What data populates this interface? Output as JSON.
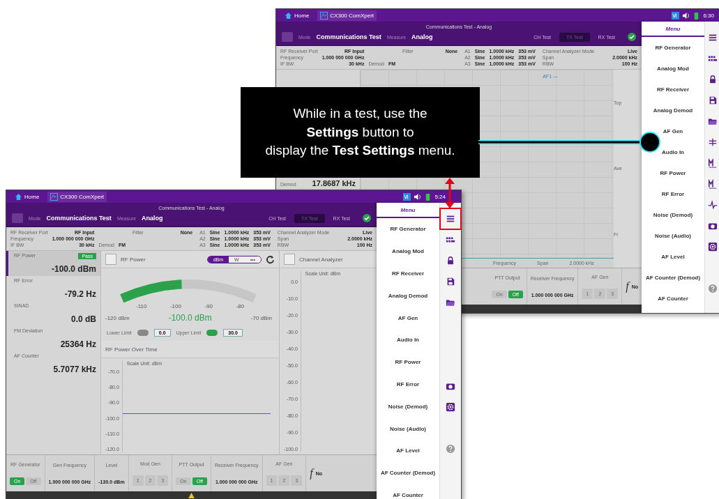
{
  "callout": {
    "lines": [
      "While in a test, use the",
      "**Settings** button to",
      "display the **Test Settings** menu."
    ]
  },
  "back": {
    "topbar": {
      "home": "Home",
      "app": "CX300 ComXpert",
      "time": "6:30"
    },
    "header": {
      "title": "Communications Test - Analog",
      "mode_label": "Mode",
      "mode": "Communications Test",
      "measure_label": "Measure",
      "measure": "Analog",
      "tabs": [
        {
          "label": "CH Test",
          "selected": false
        },
        {
          "label": "TX Test",
          "selected": true
        },
        {
          "label": "RX Test",
          "selected": false
        }
      ]
    },
    "info": {
      "receiver": [
        [
          "RF Receiver Port",
          "RF Input"
        ],
        [
          "Frequency",
          "1.000 000 000 GHz"
        ],
        [
          "IF BW",
          "30 kHz",
          "Demod",
          "FM"
        ]
      ],
      "filter": [
        "Filter",
        "None"
      ],
      "tones": [
        [
          "A1",
          "Sine",
          "1.0000 kHz",
          "353 mV"
        ],
        [
          "A2",
          "Sine",
          "1.0000 kHz",
          "353 mV"
        ],
        [
          "A3",
          "Sine",
          "1.0000 kHz",
          "353 mV"
        ]
      ],
      "analyzer": [
        [
          "Channel Analyzer Mode",
          "Live"
        ],
        [
          "Span",
          "2.0000 kHz"
        ],
        [
          "RBW",
          "100 Hz"
        ]
      ]
    },
    "reading": {
      "label": "Demod",
      "value": "17.8687 kHz"
    },
    "chart": {
      "marker": "AF1 —",
      "side_labels": [
        "Top",
        "Ave",
        "Fr"
      ],
      "footer": [
        "Frequency",
        "Span",
        "2.0000 kHz"
      ]
    },
    "bottom": [
      {
        "kind": "toggle",
        "label": "PTT Output",
        "options": [
          {
            "label": "On",
            "selected": false
          },
          {
            "label": "Off",
            "selected": true
          }
        ]
      },
      {
        "kind": "value",
        "label": "Receiver Frequency",
        "value": "1.000 000 000 GHz"
      },
      {
        "kind": "keys",
        "label": "AF Gen",
        "options": [
          {
            "label": "1",
            "selected": false
          },
          {
            "label": "2",
            "selected": false
          },
          {
            "label": "3",
            "selected": false
          }
        ]
      },
      {
        "kind": "func",
        "label": "f",
        "value": "No"
      }
    ],
    "menu": {
      "title": "Menu",
      "items": [
        "RF Generator",
        "Analog Mod",
        "RF Receiver",
        "Analog Demod",
        "AF Gen",
        "Audio In",
        "RF Power",
        "RF Error",
        "Noise (Demod)",
        "Noise (Audio)",
        "AF Level",
        "AF Counter (Demod)",
        "AF Counter"
      ]
    },
    "icons": [
      {
        "kind": "menu"
      },
      {
        "kind": "grid"
      },
      {
        "kind": "lock"
      },
      {
        "kind": "save"
      },
      {
        "kind": "folder"
      },
      {
        "kind": "filter"
      },
      {
        "kind": "marker"
      },
      {
        "kind": "marker"
      },
      {
        "kind": "pulse"
      },
      {
        "kind": "camera"
      },
      {
        "kind": "settings"
      },
      {
        "kind": "spacer"
      },
      {
        "kind": "help"
      }
    ]
  },
  "front": {
    "topbar": {
      "home": "Home",
      "app": "CX300 ComXpert",
      "time": "5:24"
    },
    "header": {
      "title": "Communications Test - Analog",
      "mode_label": "Mode",
      "mode": "Communications Test",
      "measure_label": "Measure",
      "measure": "Analog",
      "tabs": [
        {
          "label": "CH Test",
          "selected": false
        },
        {
          "label": "TX Test",
          "selected": true
        },
        {
          "label": "RX Test",
          "selected": false
        }
      ]
    },
    "info": {
      "receiver": [
        [
          "RF Receiver Port",
          "RF Input"
        ],
        [
          "Frequency",
          "1.000 000 000 GHz"
        ],
        [
          "IF BW",
          "30 kHz",
          "Demod",
          "FM"
        ]
      ],
      "filter": [
        "Filter",
        "None"
      ],
      "tones": [
        [
          "A1",
          "Sine",
          "1.0000 kHz",
          "353 mV"
        ],
        [
          "A2",
          "Sine",
          "1.0000 kHz",
          "353 mV"
        ],
        [
          "A3",
          "Sine",
          "1.0000 kHz",
          "353 mV"
        ]
      ],
      "analyzer": [
        [
          "Channel Analyzer Mode",
          "Live"
        ],
        [
          "Span",
          "2.0000 kHz"
        ],
        [
          "RBW",
          "100 Hz"
        ]
      ]
    },
    "readings": [
      {
        "label": "RF Power",
        "value": "-100.0 dBm",
        "badge": "Pass",
        "selected": true
      },
      {
        "label": "RF Error",
        "value": "-79.2 Hz",
        "selected": false
      },
      {
        "label": "SINAD",
        "value": "0.0 dB",
        "selected": false
      },
      {
        "label": "FM Deviation",
        "value": "25364 Hz",
        "selected": false
      },
      {
        "label": "AF Counter",
        "value": "5.7077 kHz",
        "selected": false
      }
    ],
    "rf_power": {
      "title": "RF Power",
      "units": [
        {
          "label": "dBm",
          "selected": true
        },
        {
          "label": "W",
          "selected": false
        },
        {
          "label": "•••",
          "selected": false
        }
      ],
      "scale": [
        "-110",
        "-100",
        "-90",
        "-80"
      ],
      "min": "-120 dBm",
      "max": "-70 dBm",
      "reading": "-100.0 dBm",
      "level": 0.45,
      "limits": [
        {
          "label": "Lower Limit",
          "on": false,
          "value": "0.0"
        },
        {
          "label": "Upper Limit",
          "on": true,
          "value": "30.0"
        }
      ]
    },
    "over_time": {
      "title": "RF Power Over Time",
      "scale": "Scale Unit: dBm",
      "yticks": [
        "-70.0",
        "-80.0",
        "-90.0",
        "-100.0",
        "-110.0",
        "-120.0"
      ]
    },
    "analyzer": {
      "title": "Channel Analyzer",
      "scale": "Scale Unit: dBm",
      "yticks": [
        "0.0",
        "-10.0",
        "-20.0",
        "-30.0",
        "-40.0",
        "-50.0",
        "-60.0",
        "-70.0",
        "-80.0",
        "-90.0",
        "-100.0"
      ]
    },
    "bottom": [
      {
        "kind": "toggle",
        "label": "RF Generator",
        "options": [
          {
            "label": "On",
            "selected": true
          },
          {
            "label": "Off",
            "selected": false
          }
        ]
      },
      {
        "kind": "value",
        "label": "Gen Frequency",
        "value": "1.000 000 000 GHz"
      },
      {
        "kind": "value",
        "label": "Level",
        "value": "-130.0 dBm"
      },
      {
        "kind": "keys",
        "label": "Mod Gen",
        "options": [
          {
            "label": "1",
            "selected": false
          },
          {
            "label": "2",
            "selected": false
          },
          {
            "label": "3",
            "selected": false
          }
        ]
      },
      {
        "kind": "toggle",
        "label": "PTT Output",
        "options": [
          {
            "label": "On",
            "selected": false
          },
          {
            "label": "Off",
            "selected": true
          }
        ]
      },
      {
        "kind": "value",
        "label": "Receiver Frequency",
        "value": "1.000 000 000 GHz"
      },
      {
        "kind": "keys",
        "label": "AF Gen",
        "options": [
          {
            "label": "1",
            "selected": false
          },
          {
            "label": "2",
            "selected": false
          },
          {
            "label": "3",
            "selected": false
          }
        ]
      },
      {
        "kind": "func",
        "label": "f",
        "value": "No"
      }
    ],
    "menu": {
      "title": "Menu",
      "items": [
        "RF Generator",
        "Analog Mod",
        "RF Receiver",
        "Analog Demod",
        "AF Gen",
        "Audio In",
        "RF Power",
        "RF Error",
        "Noise (Demod)",
        "Noise (Audio)",
        "AF Level",
        "AF Counter (Demod)",
        "AF Counter"
      ]
    },
    "icons": [
      {
        "kind": "menu"
      },
      {
        "kind": "grid"
      },
      {
        "kind": "lock"
      },
      {
        "kind": "save"
      },
      {
        "kind": "folder"
      },
      {
        "kind": "spacer"
      },
      {
        "kind": "spacer"
      },
      {
        "kind": "spacer"
      },
      {
        "kind": "camera"
      },
      {
        "kind": "settings"
      },
      {
        "kind": "spacer"
      },
      {
        "kind": "help"
      }
    ]
  }
}
